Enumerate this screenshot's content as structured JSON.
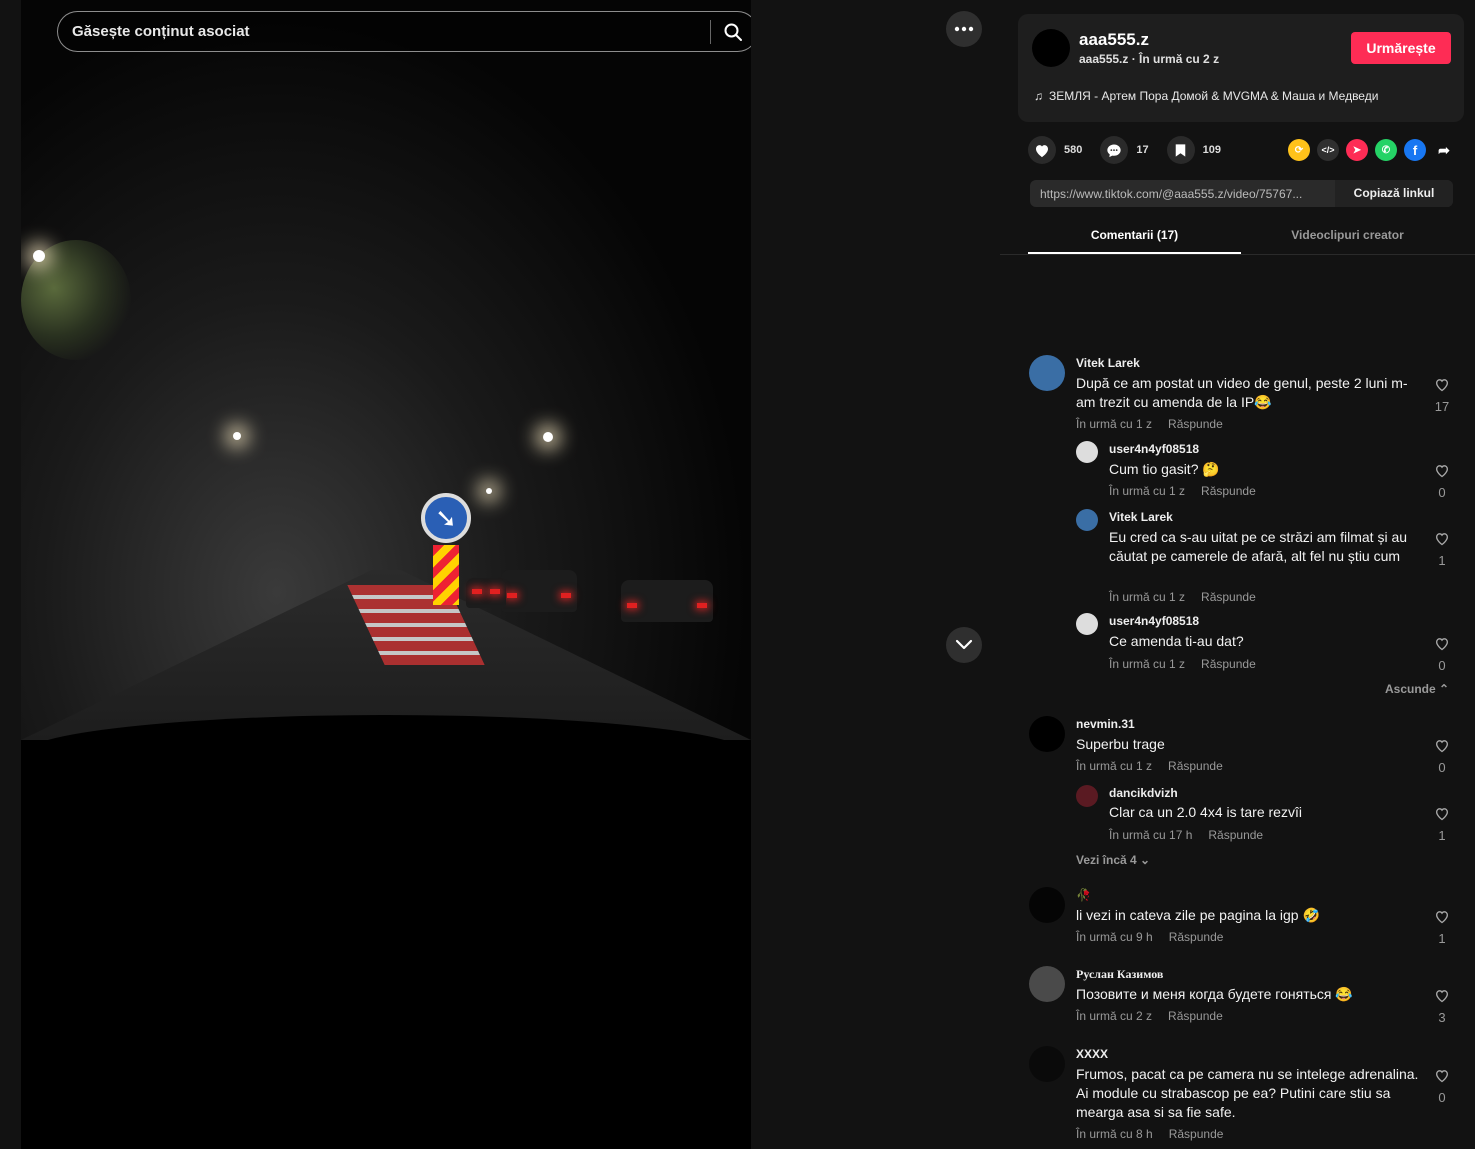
{
  "search": {
    "placeholder": "Găsește conținut asociat"
  },
  "author": {
    "name": "aaa555.z",
    "subtitle": "aaa555.z · În urmă cu 2 z",
    "follow_label": "Urmărește",
    "music": "ЗЕМЛЯ - Артем Пора Домой & MVGMA & Маша и Медведи"
  },
  "stats": {
    "likes": "580",
    "comments": "17",
    "saves": "109"
  },
  "share_icons": [
    "repost-icon",
    "embed-icon",
    "send-icon",
    "whatsapp-icon",
    "facebook-icon",
    "share-arrow-icon"
  ],
  "link": {
    "url": "https://www.tiktok.com/@aaa555.z/video/75767...",
    "copy_label": "Copiază linkul"
  },
  "tabs": {
    "comments": "Comentarii (17)",
    "creator_videos": "Videoclipuri creator"
  },
  "reply_label": "Răspunde",
  "comments": [
    {
      "user": "Vitek Larek",
      "text": "După ce am postat un video de genul, peste 2 luni m-am trezit cu amenda de la IP😂",
      "time": "În urmă cu 1 z",
      "likes": "17"
    },
    {
      "user": "user4n4yf08518",
      "text": "Cum tio gasit? 🤔",
      "time": "În urmă cu 1 z",
      "likes": "0"
    },
    {
      "user": "Vitek Larek",
      "text": "Eu cred ca s-au uitat pe ce străzi am filmat și au căutat pe camerele de afară, alt fel nu știu cum",
      "time": "În urmă cu 1 z",
      "likes": "1"
    },
    {
      "user": "user4n4yf08518",
      "text": "Ce amenda ti-au dat?",
      "time": "În urmă cu 1 z",
      "likes": "0"
    },
    {
      "user": "nevmin.31",
      "text": "Superbu trage",
      "time": "În urmă cu 1 z",
      "likes": "0"
    },
    {
      "user": "dancikdvizh",
      "text": "Clar ca un 2.0 4x4 is tare rezvîi",
      "time": "În urmă cu 17 h",
      "likes": "1"
    },
    {
      "user": "🥀",
      "text": "li vezi in cateva zile pe pagina la igp 🤣",
      "time": "În urmă cu 9 h",
      "likes": "1"
    },
    {
      "user": "Руслан Казимов",
      "text": "Позовите и меня когда будете гоняться 😂",
      "time": "În urmă cu 2 z",
      "likes": "3"
    },
    {
      "user": "XXXX",
      "text": "Frumos, pacat ca pe camera nu se intelege adrenalina. Ai module cu strabascop pe ea? Putini care stiu sa mearga asa si sa fie safe.",
      "time": "În urmă cu 8 h",
      "likes": "0"
    }
  ],
  "toggles": {
    "hide": "Ascunde",
    "more": "Vezi încă 4"
  }
}
